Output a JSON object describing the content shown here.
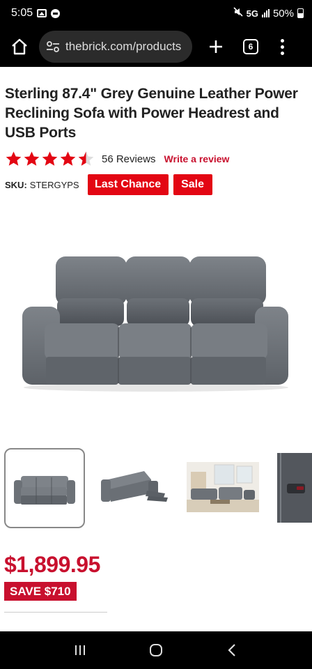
{
  "status_bar": {
    "time": "5:05",
    "network": "5G",
    "battery": "50%"
  },
  "browser": {
    "url": "thebrick.com/products",
    "tab_count": "6"
  },
  "product": {
    "title": "Sterling 87.4\" Grey Genuine Leather Power Reclining Sofa with Power Headrest and USB Ports",
    "rating": 4.5,
    "reviews_label": "56 Reviews",
    "write_review": "Write a review",
    "sku_label": "SKU:",
    "sku_value": "STERGYPS",
    "badges": [
      "Last Chance",
      "Sale"
    ],
    "price": "$1,899.95",
    "save": "SAVE $710"
  },
  "colors": {
    "accent": "#c8102e",
    "badge": "#e30613",
    "star": "#e30613"
  }
}
